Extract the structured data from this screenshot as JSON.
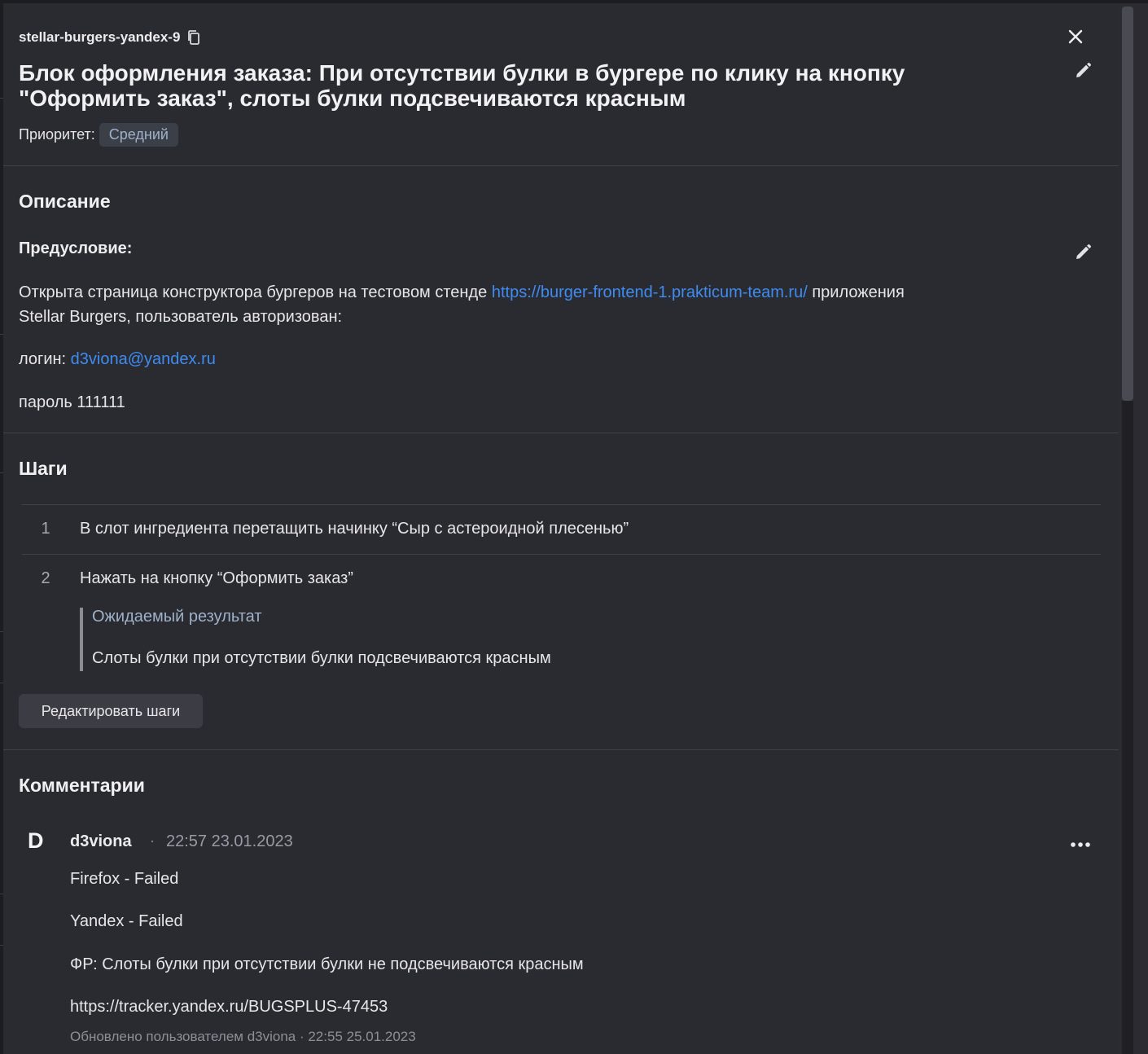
{
  "case": {
    "id": "stellar-burgers-yandex-9",
    "title": "Блок оформления заказа: При отсутствии булки в бургере по клику на кнопку \"Оформить заказ\", слоты булки подсвечиваются красным",
    "priority_label": "Приоритет:",
    "priority_value": "Средний"
  },
  "description": {
    "heading": "Описание",
    "precondition_heading": "Предусловие:",
    "line1_before": "Открыта страница конструктора бургеров на тестовом стенде ",
    "line1_link": "https://burger-frontend-1.prakticum-team.ru/",
    "line1_after": " приложения",
    "line2": "Stellar Burgers, пользователь авторизован:",
    "login_label": "логин: ",
    "login_value": "d3viona@yandex.ru",
    "password_line": "пароль 111111"
  },
  "steps": {
    "heading": "Шаги",
    "items": [
      {
        "num": "1",
        "text": "В слот ингредиента перетащить начинку “Сыр с астероидной плесенью”"
      },
      {
        "num": "2",
        "text": "Нажать на кнопку “Оформить заказ”"
      }
    ],
    "expected_label": "Ожидаемый результат",
    "expected_text": "Слоты булки при отсутствии булки подсвечиваются красным",
    "edit_button": "Редактировать шаги"
  },
  "comments": {
    "heading": "Комментарии",
    "items": [
      {
        "avatar": "D",
        "author": "d3viona",
        "dot": "·",
        "time": "22:57 23.01.2023",
        "lines": [
          "Firefox - Failed",
          "Yandex - Failed",
          "ФР: Слоты булки при отсутствии булки не подсвечиваются красным"
        ],
        "link": "https://tracker.yandex.ru/BUGSPLUS-47453",
        "updated": "Обновлено пользователем d3viona  ·  22:55 25.01.2023"
      }
    ]
  },
  "icons": {
    "copy": "copy-icon",
    "close": "close-icon",
    "edit": "pencil-icon",
    "more": "more-horizontal-icon"
  },
  "colors": {
    "panel_bg": "#2a2a31",
    "link": "#3f8cf0",
    "badge_bg": "#3b3f48",
    "badge_text": "#9fb1c8"
  }
}
